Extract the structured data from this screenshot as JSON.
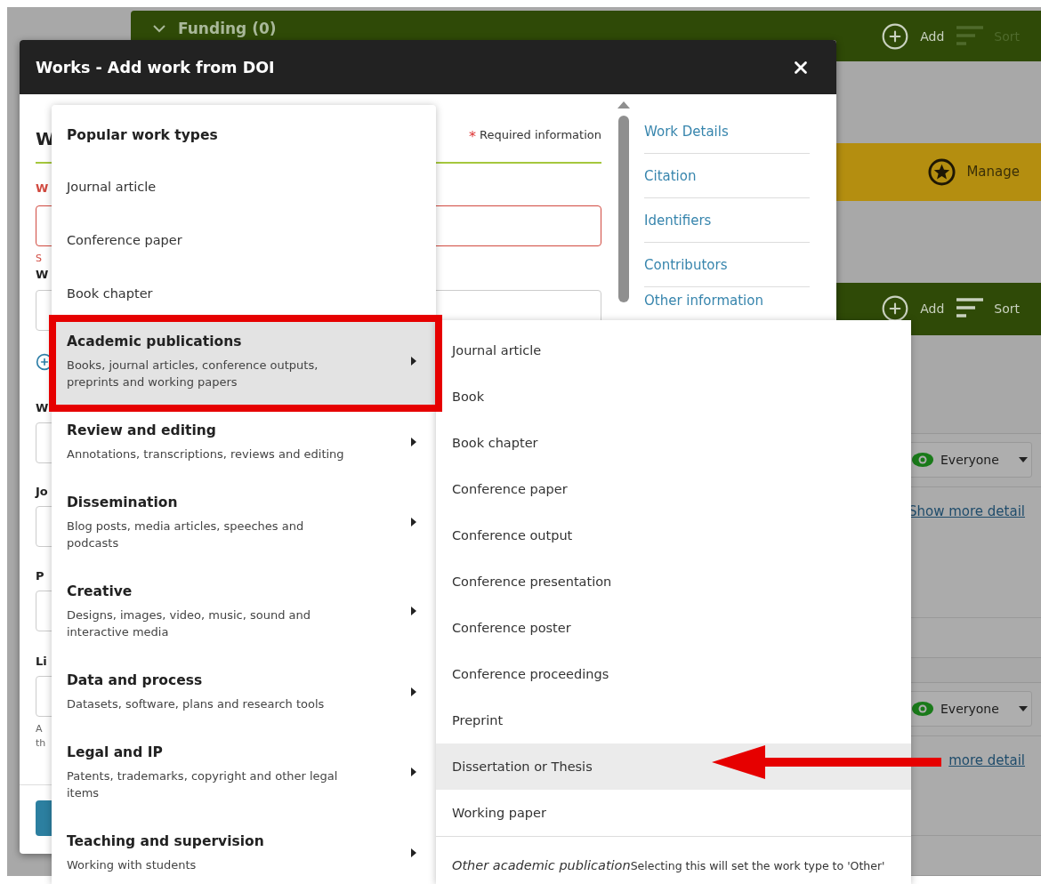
{
  "backdrop": {
    "funding_bar": {
      "title": "Funding (0)",
      "actions": [
        {
          "label": "Add",
          "kind": "add",
          "disabled": false
        },
        {
          "label": "Sort",
          "kind": "sort",
          "disabled": true
        }
      ]
    },
    "manage_bar": {
      "action": {
        "label": "Manage"
      }
    },
    "works_bar": {
      "actions": [
        {
          "label": "Add",
          "kind": "add",
          "disabled": false
        },
        {
          "label": "Sort",
          "kind": "sort",
          "disabled": false
        }
      ]
    },
    "cards": [
      {
        "visibility": "Everyone",
        "link": "Show more detail"
      },
      {
        "visibility": "Everyone",
        "link": "more detail"
      }
    ]
  },
  "modal": {
    "title": "Works - Add work from DOI",
    "heading": "W",
    "required_marker": "*",
    "required_note": "Required information",
    "form": [
      {
        "kind": "label",
        "text": "W",
        "error": true
      },
      {
        "kind": "field",
        "error": true
      },
      {
        "kind": "hint",
        "text": "S",
        "error": true
      },
      {
        "kind": "label",
        "text": "W",
        "error": false
      },
      {
        "kind": "field",
        "error": false
      },
      {
        "kind": "add"
      },
      {
        "kind": "label",
        "text": "W",
        "error": false
      },
      {
        "kind": "field",
        "error": false
      },
      {
        "kind": "label",
        "text": "Jo",
        "error": false
      },
      {
        "kind": "field",
        "error": false
      },
      {
        "kind": "label",
        "text": "P",
        "error": false
      },
      {
        "kind": "field",
        "error": false
      },
      {
        "kind": "label",
        "text": "Li",
        "error": false
      },
      {
        "kind": "field",
        "error": false
      },
      {
        "kind": "hint",
        "text": "A",
        "error": false
      },
      {
        "kind": "hint",
        "text": "th",
        "error": false
      }
    ],
    "nav": [
      "Work Details",
      "Citation",
      "Identifiers",
      "Contributors",
      "Other information"
    ]
  },
  "menu": {
    "heading": "Popular work types",
    "popular": [
      "Journal article",
      "Conference paper",
      "Book chapter"
    ],
    "categories": [
      {
        "title": "Academic publications",
        "description": "Books, journal articles, conference outputs, preprints and working papers",
        "selected": true
      },
      {
        "title": "Review and editing",
        "description": "Annotations, transcriptions, reviews and editing",
        "selected": false
      },
      {
        "title": "Dissemination",
        "description": "Blog posts, media articles, speeches and podcasts",
        "selected": false
      },
      {
        "title": "Creative",
        "description": "Designs, images, video, music, sound and interactive media",
        "selected": false
      },
      {
        "title": "Data and process",
        "description": "Datasets, software, plans and research tools",
        "selected": false
      },
      {
        "title": "Legal and IP",
        "description": "Patents, trademarks, copyright and other legal items",
        "selected": false
      },
      {
        "title": "Teaching and supervision",
        "description": "Working with students",
        "selected": false
      }
    ]
  },
  "submenu": {
    "items": [
      {
        "label": "Journal article",
        "highlighted": false
      },
      {
        "label": "Book",
        "highlighted": false
      },
      {
        "label": "Book chapter",
        "highlighted": false
      },
      {
        "label": "Conference paper",
        "highlighted": false
      },
      {
        "label": "Conference output",
        "highlighted": false
      },
      {
        "label": "Conference presentation",
        "highlighted": false
      },
      {
        "label": "Conference poster",
        "highlighted": false
      },
      {
        "label": "Conference proceedings",
        "highlighted": false
      },
      {
        "label": "Preprint",
        "highlighted": false
      },
      {
        "label": "Dissertation or Thesis",
        "highlighted": true
      },
      {
        "label": "Working paper",
        "highlighted": false
      }
    ],
    "other": {
      "label": "Other academic publication",
      "note": "Selecting this will set the work type to 'Other'"
    }
  }
}
